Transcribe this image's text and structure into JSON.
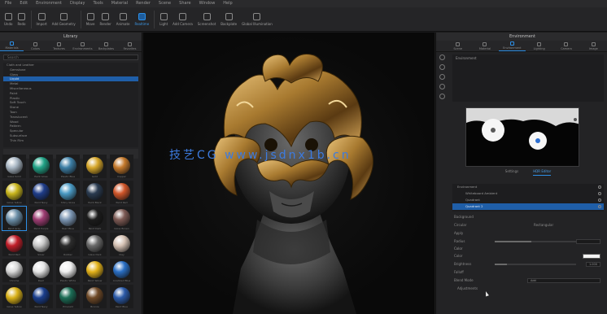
{
  "menu": [
    "File",
    "Edit",
    "Environment",
    "Display",
    "Tools",
    "Material",
    "Render",
    "Scene",
    "Share",
    "Window",
    "Help"
  ],
  "toolbar": {
    "buttons": [
      {
        "label": "Undo",
        "icon": "undo-icon"
      },
      {
        "label": "Redo",
        "icon": "redo-icon"
      },
      {
        "label": "Import",
        "icon": "import-icon"
      },
      {
        "label": "Add Geometry",
        "icon": "geometry-icon"
      },
      {
        "label": "Move",
        "icon": "move-icon"
      },
      {
        "label": "Render",
        "icon": "render-icon"
      },
      {
        "label": "Animate",
        "icon": "animate-icon"
      },
      {
        "label": "Realtime",
        "icon": "realtime-icon"
      },
      {
        "label": "Light",
        "icon": "light-icon"
      },
      {
        "label": "Add Camera",
        "icon": "camera-icon"
      },
      {
        "label": "Screenshot",
        "icon": "screenshot-icon"
      },
      {
        "label": "Backplate",
        "icon": "backplate-icon"
      },
      {
        "label": "Global Illumination",
        "icon": "gi-icon"
      }
    ]
  },
  "left_panel": {
    "title": "Library",
    "tabs": [
      "Materials",
      "Colors",
      "Textures",
      "Environments",
      "Backplates",
      "Favorites"
    ],
    "search_placeholder": "Search",
    "tree": [
      "Cloth and Leather",
      "Gemstone",
      "Glass",
      "Liquid",
      "Metal",
      "Miscellaneous",
      "Paint",
      "Plastic",
      "Soft Touch",
      "Stone",
      "Toon",
      "Translucent",
      "Wood",
      "Pattern",
      "Specular",
      "Subsurface",
      "Thin Film"
    ],
    "tree_selected_index": 3,
    "materials": [
      {
        "label": "Glass Solid",
        "color": "#a9b7c4"
      },
      {
        "label": "Paint Gloss",
        "color": "#22a387"
      },
      {
        "label": "Plastic Blue",
        "color": "#3d7fa6"
      },
      {
        "label": "Gold",
        "color": "#d7a72a"
      },
      {
        "label": "Copper",
        "color": "#c4792c"
      },
      {
        "label": "Gloss Yellow",
        "color": "#c9b61d"
      },
      {
        "label": "Paint Navy",
        "color": "#1f3d89"
      },
      {
        "label": "Shiny Gloss",
        "color": "#4a9ac4"
      },
      {
        "label": "Paint Black",
        "color": "#2a3b50"
      },
      {
        "label": "Paint Red",
        "color": "#d0562a"
      },
      {
        "label": "Paint Gray",
        "color": "#6c8fa8"
      },
      {
        "label": "Paint Purple",
        "color": "#9e3d73"
      },
      {
        "label": "Pearl Blue",
        "color": "#7c96b3"
      },
      {
        "label": "Paint Dark",
        "color": "#1c1c1c"
      },
      {
        "label": "Gloss Brown",
        "color": "#7d5a54"
      },
      {
        "label": "Paint Red",
        "color": "#c21f2a"
      },
      {
        "label": "Silver",
        "color": "#c9c9c9"
      },
      {
        "label": "Rubber",
        "color": "#2c2c2c"
      },
      {
        "label": "Glass Dark",
        "color": "#6a6a6a"
      },
      {
        "label": "Clay",
        "color": "#d6c2b4"
      },
      {
        "label": "Chrome",
        "color": "#d8d8d8"
      },
      {
        "label": "Pearl",
        "color": "#e6e6e6"
      },
      {
        "label": "Plastic White",
        "color": "#f0f0f0"
      },
      {
        "label": "Paint Yellow",
        "color": "#e3b21a"
      },
      {
        "label": "Anodized Blue",
        "color": "#2a6fc4"
      },
      {
        "label": "Gloss Yellow",
        "color": "#d9b118"
      },
      {
        "label": "Paint Navy",
        "color": "#1a3e8c"
      },
      {
        "label": "Emerald",
        "color": "#1c6d56"
      },
      {
        "label": "Bronze",
        "color": "#6f4a28"
      },
      {
        "label": "Paint Blue",
        "color": "#2b5aa8"
      }
    ],
    "selected_material_index": 10
  },
  "viewport": {
    "watermark": "技艺CG  www.jsdnx1b.cn"
  },
  "right_panel": {
    "title": "Environment",
    "tabs": [
      "Scene",
      "Material",
      "Environment",
      "Lighting",
      "Camera",
      "Image"
    ],
    "active_tab_index": 2,
    "env_list_label": "Environment",
    "sub_tabs": [
      "Settings",
      "HDR Editor"
    ],
    "active_sub_tab_index": 1,
    "layers": [
      {
        "label": "Environment",
        "selected": false
      },
      {
        "label": "Whiteboard Ambient",
        "selected": false
      },
      {
        "label": "Quadrant",
        "selected": false
      },
      {
        "label": "Quadrant 2",
        "selected": true
      }
    ],
    "background_label": "Background",
    "shape": {
      "circle": "Circular",
      "rect": "Rectangular"
    },
    "props": {
      "apply_label": "Apply",
      "radius_label": "Radius",
      "color_header": "Color",
      "color_label": "Color",
      "brightness_label": "Brightness",
      "brightness_value": "1.000",
      "falloff_label": "Falloff",
      "blend_mode_label": "Blend Mode",
      "blend_mode_value": "Add",
      "adjustments_label": "Adjustments",
      "radius_fraction": 0.45,
      "brightness_fraction": 0.15
    }
  }
}
